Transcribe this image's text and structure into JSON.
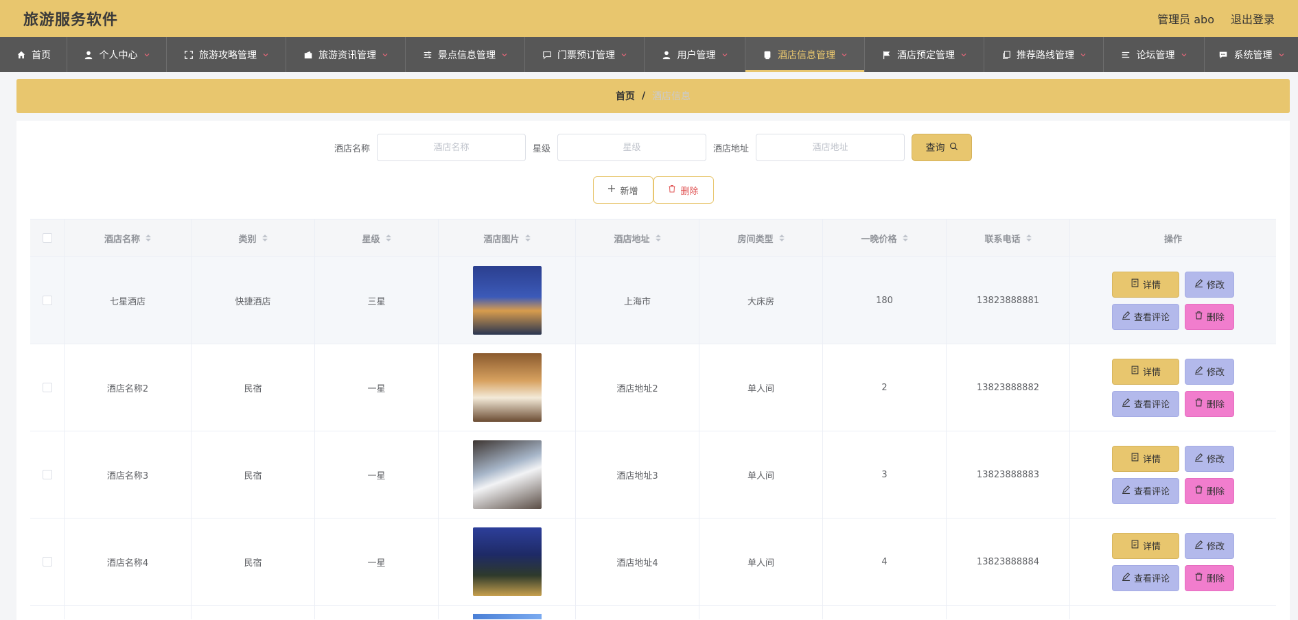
{
  "app": {
    "title": "旅游服务软件"
  },
  "header": {
    "user_label": "管理员 abo",
    "logout": "退出登录"
  },
  "nav": [
    {
      "label": "首页",
      "icon": "home-icon",
      "has_chevron": false,
      "active": false
    },
    {
      "label": "个人中心",
      "icon": "user-icon",
      "has_chevron": true,
      "active": false
    },
    {
      "label": "旅游攻略管理",
      "icon": "fullscreen-icon",
      "has_chevron": true,
      "active": false
    },
    {
      "label": "旅游资讯管理",
      "icon": "wallet-icon",
      "has_chevron": true,
      "active": false
    },
    {
      "label": "景点信息管理",
      "icon": "sliders-icon",
      "has_chevron": true,
      "active": false
    },
    {
      "label": "门票预订管理",
      "icon": "chat-icon",
      "has_chevron": true,
      "active": false
    },
    {
      "label": "用户管理",
      "icon": "user-icon",
      "has_chevron": true,
      "active": false
    },
    {
      "label": "酒店信息管理",
      "icon": "receipt-icon",
      "has_chevron": true,
      "active": true
    },
    {
      "label": "酒店预定管理",
      "icon": "flag-icon",
      "has_chevron": true,
      "active": false
    },
    {
      "label": "推荐路线管理",
      "icon": "copy-icon",
      "has_chevron": true,
      "active": false
    },
    {
      "label": "论坛管理",
      "icon": "list-icon",
      "has_chevron": true,
      "active": false
    },
    {
      "label": "系统管理",
      "icon": "message-icon",
      "has_chevron": true,
      "active": false
    }
  ],
  "breadcrumb": {
    "home": "首页",
    "separator": "/",
    "current": "酒店信息"
  },
  "search": {
    "name_label": "酒店名称",
    "name_placeholder": "酒店名称",
    "star_label": "星级",
    "star_placeholder": "星级",
    "address_label": "酒店地址",
    "address_placeholder": "酒店地址",
    "query_button": "查询"
  },
  "actions": {
    "add": "新增",
    "delete": "删除"
  },
  "table": {
    "columns": [
      "酒店名称",
      "类别",
      "星级",
      "酒店图片",
      "酒店地址",
      "房间类型",
      "一晚价格",
      "联系电话",
      "操作"
    ],
    "rows": [
      {
        "name": "七星酒店",
        "category": "快捷酒店",
        "star": "三星",
        "address": "上海市",
        "room_type": "大床房",
        "price": "180",
        "phone": "13823888881"
      },
      {
        "name": "酒店名称2",
        "category": "民宿",
        "star": "一星",
        "address": "酒店地址2",
        "room_type": "单人间",
        "price": "2",
        "phone": "13823888882"
      },
      {
        "name": "酒店名称3",
        "category": "民宿",
        "star": "一星",
        "address": "酒店地址3",
        "room_type": "单人间",
        "price": "3",
        "phone": "13823888883"
      },
      {
        "name": "酒店名称4",
        "category": "民宿",
        "star": "一星",
        "address": "酒店地址4",
        "room_type": "单人间",
        "price": "4",
        "phone": "13823888884"
      }
    ],
    "ops": {
      "detail": "详情",
      "edit": "修改",
      "comment": "查看评论",
      "delete": "删除"
    }
  }
}
